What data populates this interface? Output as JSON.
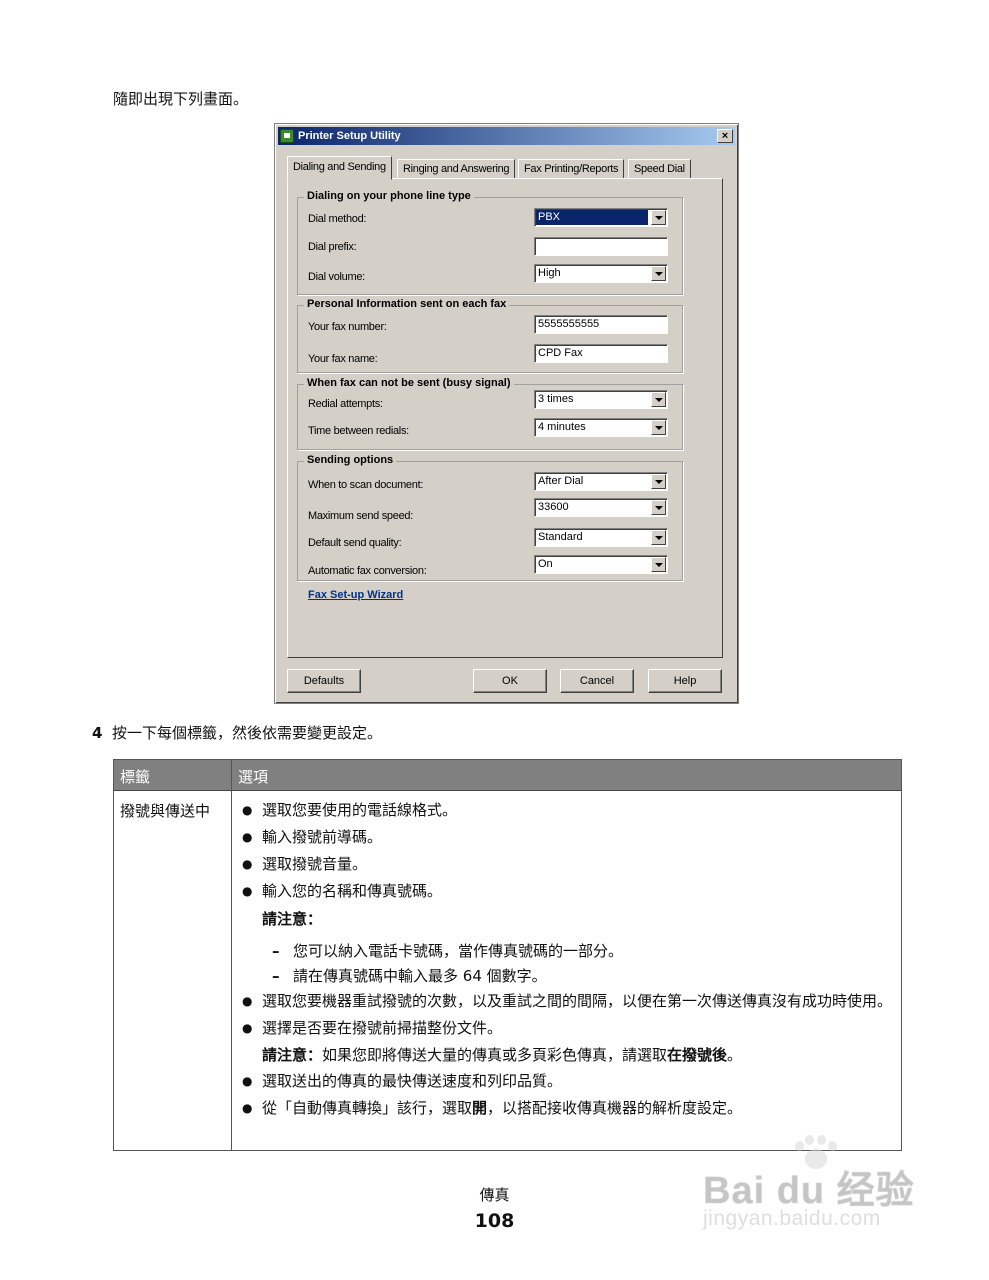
{
  "intro_text": "隨即出現下列畫面。",
  "dialog": {
    "title": "Printer Setup Utility",
    "close_glyph": "×",
    "tabs": [
      "Dialing and Sending",
      "Ringing and Answering",
      "Fax Printing/Reports",
      "Speed Dial"
    ],
    "groups": {
      "dialing": {
        "title": "Dialing on your phone line type",
        "dial_method_label": "Dial method:",
        "dial_method_value": "PBX",
        "dial_prefix_label": "Dial prefix:",
        "dial_prefix_value": "",
        "dial_volume_label": "Dial volume:",
        "dial_volume_value": "High"
      },
      "personal": {
        "title": "Personal Information sent on each fax",
        "fax_number_label": "Your fax number:",
        "fax_number_value": "5555555555",
        "fax_name_label": "Your fax name:",
        "fax_name_value": "CPD Fax"
      },
      "busy": {
        "title": "When fax can not be sent (busy signal)",
        "redial_label": "Redial attempts:",
        "redial_value": "3 times",
        "time_label": "Time between redials:",
        "time_value": "4 minutes"
      },
      "sending": {
        "title": "Sending options",
        "scan_label": "When to scan document:",
        "scan_value": "After Dial",
        "speed_label": "Maximum send speed:",
        "speed_value": "33600",
        "quality_label": "Default send quality:",
        "quality_value": "Standard",
        "conversion_label": "Automatic fax conversion:",
        "conversion_value": "On"
      }
    },
    "wizard_link": "Fax Set-up Wizard",
    "buttons": {
      "defaults": "Defaults",
      "ok": "OK",
      "cancel": "Cancel",
      "help": "Help"
    }
  },
  "step": {
    "number": "4",
    "text": "按一下每個標籤，然後依需要變更設定。"
  },
  "table": {
    "headers": [
      "標籤",
      "選項"
    ],
    "tab_name": "撥號與傳送中",
    "bullets_1": [
      "選取您要使用的電話線格式。",
      "輸入撥號前導碼。",
      "選取撥號音量。",
      "輸入您的名稱和傳真號碼。"
    ],
    "note_label": "請注意：",
    "dashes": [
      "您可以納入電話卡號碼，當作傳真號碼的一部分。",
      "請在傳真號碼中輸入最多 64 個數字。"
    ],
    "bullets_2": [
      "選取您要機器重試撥號的次數，以及重試之間的間隔，以便在第一次傳送傳真沒有成功時使用。",
      "選擇是否要在撥號前掃描整份文件。"
    ],
    "note2_label": "請注意：",
    "note2_text_a": "如果您即將傳送大量的傳真或多頁彩色傳真，請選取",
    "note2_bold": "在撥號後",
    "note2_text_b": "。",
    "bullet_speed": "選取送出的傳真的最快傳送速度和列印品質。",
    "bullet_last_a": "從「自動傳真轉換」該行，選取",
    "bullet_last_bold": "開",
    "bullet_last_b": "，以搭配接收傳真機器的解析度設定。"
  },
  "footer": {
    "title": "傳真",
    "page": "108"
  },
  "watermark": {
    "logo": "Bai du 经验",
    "url": "jingyan.baidu.com"
  }
}
